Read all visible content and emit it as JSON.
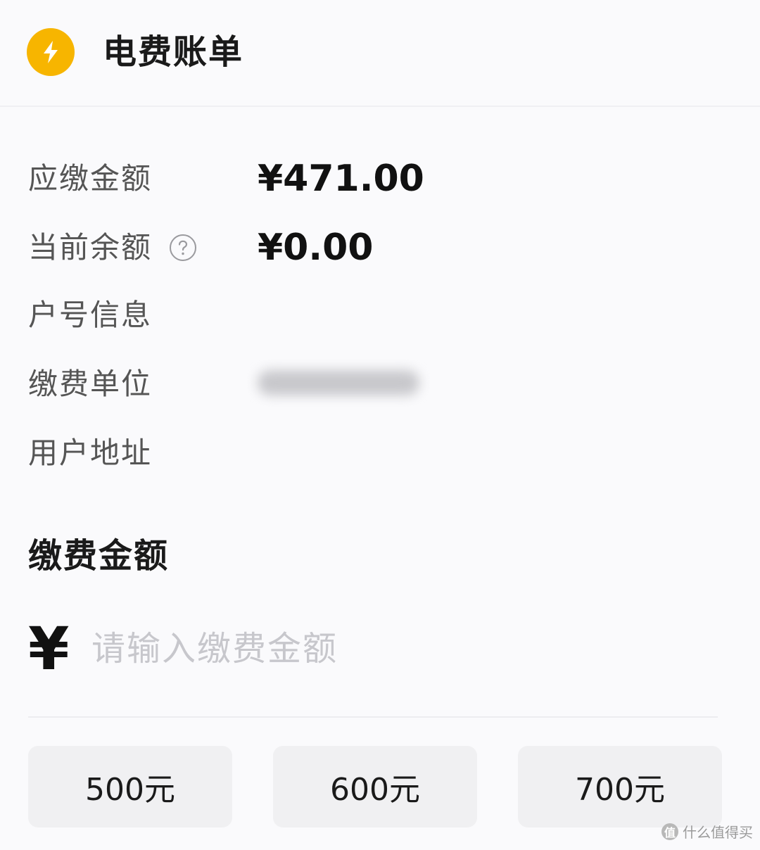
{
  "header": {
    "title": "电费账单",
    "icon": "lightning-bolt-icon",
    "accent_color": "#f7b500"
  },
  "bill_info": {
    "amount_due": {
      "label": "应缴金额",
      "value": "¥471.00"
    },
    "current_balance": {
      "label": "当前余额",
      "value": "¥0.00",
      "help_icon": "question-circle-icon"
    },
    "account_info": {
      "label": "户号信息",
      "value": ""
    },
    "payment_unit": {
      "label": "缴费单位",
      "value": ""
    },
    "user_address": {
      "label": "用户地址",
      "value": ""
    }
  },
  "payment": {
    "section_title": "缴费金额",
    "currency_symbol": "¥",
    "input_placeholder": "请输入缴费金额",
    "input_value": "",
    "quick_amounts": [
      "500元",
      "600元",
      "700元"
    ]
  },
  "watermark": {
    "logo_text": "值",
    "text": "什么值得买"
  }
}
